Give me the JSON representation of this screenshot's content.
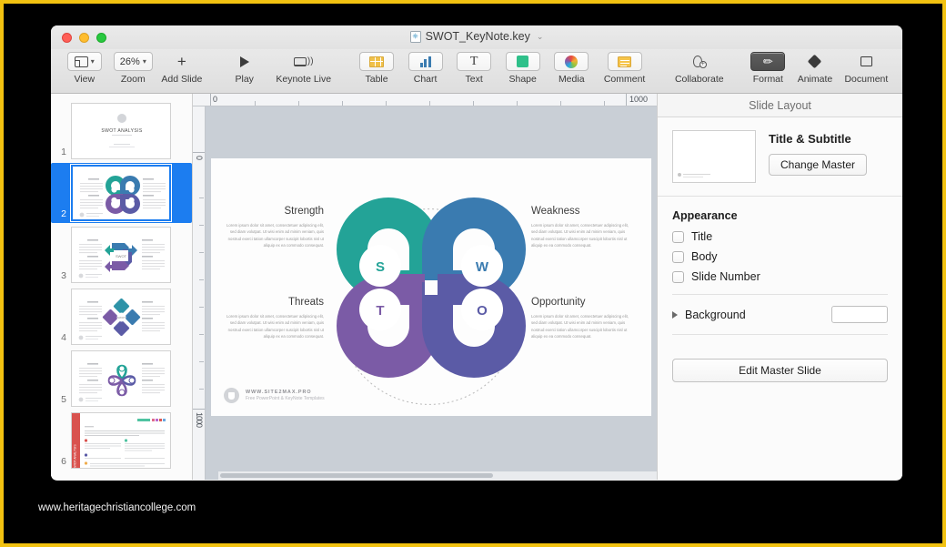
{
  "window": {
    "title": "SWOT_KeyNote.key",
    "app_icon": "keynote-doc-icon",
    "title_chevron": "⌄"
  },
  "toolbar": {
    "items": [
      {
        "label": "View",
        "icon": "view-layout-icon",
        "has_chevron": true
      },
      {
        "label": "Zoom",
        "icon": "zoom-value",
        "value": "26%",
        "has_chevron": true
      },
      {
        "label": "Add Slide",
        "icon": "plus-icon",
        "has_chevron": false
      },
      {
        "label": "Play",
        "icon": "play-triangle-icon",
        "has_chevron": false
      },
      {
        "label": "Keynote Live",
        "icon": "broadcast-screen-icon",
        "has_chevron": false
      },
      {
        "label": "Table",
        "icon": "table-grid-icon",
        "has_chevron": false
      },
      {
        "label": "Chart",
        "icon": "bar-chart-icon",
        "has_chevron": false
      },
      {
        "label": "Text",
        "icon": "text-t-icon",
        "has_chevron": false
      },
      {
        "label": "Shape",
        "icon": "green-square-icon",
        "has_chevron": false
      },
      {
        "label": "Media",
        "icon": "color-wheel-icon",
        "has_chevron": false
      },
      {
        "label": "Comment",
        "icon": "comment-lines-icon",
        "has_chevron": false
      },
      {
        "label": "Collaborate",
        "icon": "add-person-icon",
        "has_chevron": false
      },
      {
        "label": "Format",
        "icon": "paintbrush-icon",
        "selected": true
      },
      {
        "label": "Animate",
        "icon": "diamond-icon",
        "selected": false
      },
      {
        "label": "Document",
        "icon": "document-square-icon",
        "selected": false
      }
    ]
  },
  "navigator": {
    "slides": [
      {
        "number": "1",
        "selected": false,
        "type": "title",
        "title": "SWOT ANALYSIS"
      },
      {
        "number": "2",
        "selected": true,
        "type": "pinwheel",
        "title": ""
      },
      {
        "number": "3",
        "selected": false,
        "type": "arrows",
        "title": ""
      },
      {
        "number": "4",
        "selected": false,
        "type": "diamonds",
        "title": ""
      },
      {
        "number": "5",
        "selected": false,
        "type": "petals",
        "title": ""
      },
      {
        "number": "6",
        "selected": false,
        "type": "textdoc",
        "title": ""
      }
    ]
  },
  "ruler": {
    "h_labels": [
      "0",
      "1000"
    ],
    "v_labels": [
      "0",
      "1000"
    ]
  },
  "slide": {
    "quadrants": [
      {
        "letter": "S",
        "heading": "Strength",
        "color": "#23a397",
        "body": "Lorem ipsum dolor sit amet, consectetuer adipiscing elit, sed diam volutpat. Ut wisi enim ad minim veniam, quis nostrud exerci tation ullamcorper suscipit lobortis nisl ut aliquip ex ea commodo consequat."
      },
      {
        "letter": "W",
        "heading": "Weakness",
        "color": "#3a7bb0",
        "body": "Lorem ipsum dolor sit amet, consectetuer adipiscing elit, sed diam volutpat. Ut wisi enim ad minim veniam, quis nostrud exerci tation ullamcorper suscipit lobortis nisl ut aliquip ex ea commodo consequat."
      },
      {
        "letter": "T",
        "heading": "Threats",
        "color": "#7b5ba6",
        "body": "Lorem ipsum dolor sit amet, consectetuer adipiscing elit, sed diam volutpat. Ut wisi enim ad minim veniam, quis nostrud exerci tation ullamcorper suscipit lobortis nisl ut aliquip ex ea commodo consequat."
      },
      {
        "letter": "O",
        "heading": "Opportunity",
        "color": "#5b5ba6",
        "body": "Lorem ipsum dolor sit amet, consectetuer adipiscing elit, sed diam volutpat. Ut wisi enim ad minim veniam, quis nostrud exerci tation ullamcorper suscipit lobortis nisl ut aliquip ex ea commodo consequat."
      }
    ],
    "footer": {
      "line1": "WWW.SITE2MAX.PRO",
      "line2": "Free PowerPoint & KeyNote Templates"
    }
  },
  "inspector": {
    "panel_title": "Slide Layout",
    "master_name": "Title & Subtitle",
    "change_master_label": "Change Master",
    "appearance_label": "Appearance",
    "checkboxes": [
      {
        "label": "Title",
        "checked": false
      },
      {
        "label": "Body",
        "checked": false
      },
      {
        "label": "Slide Number",
        "checked": false
      }
    ],
    "background_label": "Background",
    "edit_master_label": "Edit Master Slide"
  },
  "caption": "www.heritagechristiancollege.com",
  "colors": {
    "frame": "#f2c211",
    "selection": "#1c7df0",
    "teal": "#23a397",
    "blue": "#3a7bb0",
    "purple": "#7b5ba6",
    "indigo": "#5b5ba6"
  }
}
